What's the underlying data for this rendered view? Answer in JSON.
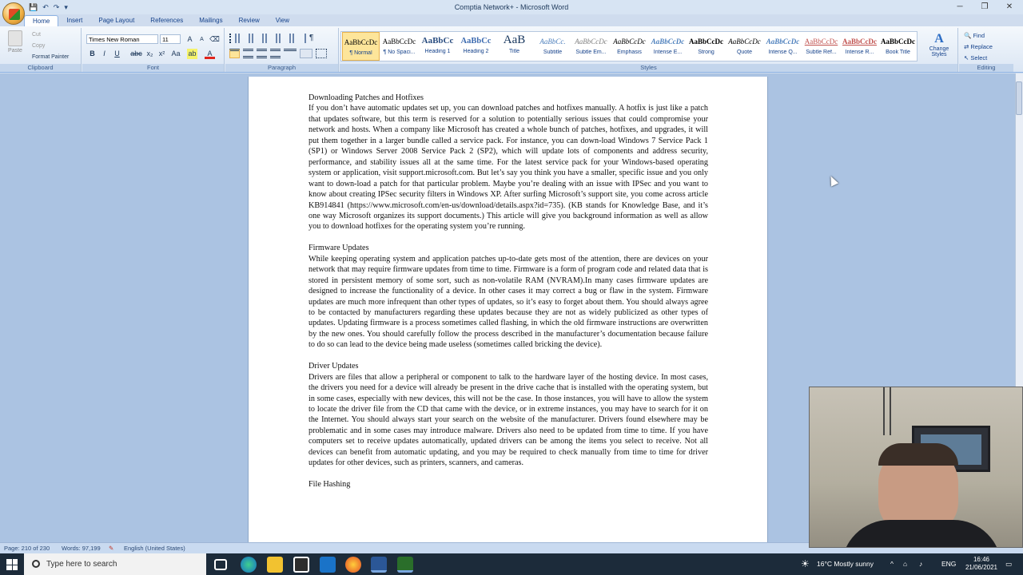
{
  "window": {
    "title": "Comptia Network+ - Microsoft Word",
    "minimize": "─",
    "restore": "❐",
    "close": "✕"
  },
  "qat": {
    "save": "💾",
    "undo": "↶",
    "redo": "↷",
    "more": "▾"
  },
  "tabs": [
    "Home",
    "Insert",
    "Page Layout",
    "References",
    "Mailings",
    "Review",
    "View"
  ],
  "clipboard": {
    "paste": "Paste",
    "cut": "Cut",
    "copy": "Copy",
    "format_painter": "Format Painter",
    "label": "Clipboard"
  },
  "font": {
    "name": "Times New Roman",
    "size": "11",
    "label": "Font",
    "bold": "B",
    "italic": "I",
    "underline": "U",
    "strike": "abc",
    "sub": "x₂",
    "sup": "x²",
    "case": "Aa",
    "grow": "A",
    "shrink": "A",
    "clear": "⌫",
    "highlight": "ab",
    "color": "A"
  },
  "paragraph": {
    "label": "Paragraph"
  },
  "styles": {
    "label": "Styles",
    "items": [
      {
        "preview": "AaBbCcDc",
        "name": "¶ Normal"
      },
      {
        "preview": "AaBbCcDc",
        "name": "¶ No Spaci..."
      },
      {
        "preview": "AaBbCc",
        "name": "Heading 1"
      },
      {
        "preview": "AaBbCc",
        "name": "Heading 2"
      },
      {
        "preview": "AaB",
        "name": "Title"
      },
      {
        "preview": "AaBbCc.",
        "name": "Subtitle"
      },
      {
        "preview": "AaBbCcDc",
        "name": "Subtle Em..."
      },
      {
        "preview": "AaBbCcDc",
        "name": "Emphasis"
      },
      {
        "preview": "AaBbCcDc",
        "name": "Intense E..."
      },
      {
        "preview": "AaBbCcDc",
        "name": "Strong"
      },
      {
        "preview": "AaBbCcDc",
        "name": "Quote"
      },
      {
        "preview": "AaBbCcDc",
        "name": "Intense Q..."
      },
      {
        "preview": "AaBbCcDc",
        "name": "Subtle Ref..."
      },
      {
        "preview": "AaBbCcDc",
        "name": "Intense R..."
      },
      {
        "preview": "AaBbCcDc",
        "name": "Book Title"
      }
    ],
    "change": "Change Styles"
  },
  "editing": {
    "label": "Editing",
    "find": "Find",
    "replace": "Replace",
    "select": "Select"
  },
  "document": {
    "h1": "Downloading Patches and Hotfixes",
    "p1": "If you don’t have automatic updates set up, you can download patches and hotfixes manually. A hotfix is just like a patch that updates software, but this term is reserved for a solution to potentially serious issues that could compromise your network and hosts. When a company like Microsoft has created a whole bunch of patches, hotfixes, and upgrades, it will put them together in a larger bundle called a service pack. For instance, you can down-load Windows 7 Service Pack 1 (SP1) or Windows Server 2008 Service Pack 2 (SP2), which will update lots of components and address security, performance, and stability issues all at the same time. For the latest service pack for your Windows-based operating system or application, visit support.microsoft.com. But let’s say you think you have a smaller, specific issue and you only want to down-load a patch for that particular problem. Maybe you’re dealing with an issue with IPSec and you want to know about creating IPSec security filters in Windows XP. After surfing Microsoft’s support site, you come across article KB914841 (https://www.microsoft.com/en-us/download/details.aspx?id=735). (KB stands for Knowledge Base, and it’s one way Microsoft organizes its support documents.) This article will give you background information as well as allow you to download hotfixes for the operating system you’re running.",
    "h2": "Firmware Updates",
    "p2": "While keeping operating system and application patches up-to-date gets most of the attention, there are devices on your network that may require firmware updates from time to time. Firmware is a form of program code and related data that is stored in persistent memory of some sort, such as non-volatile RAM (NVRAM).In many cases firmware updates are designed to increase the functionality of a device. In other cases it may correct a bug or flaw in the system. Firmware updates are much more infrequent than other types of updates, so it’s easy to forget about them. You should always agree to be contacted by manufacturers regarding these updates because they are not as widely publicized as other types of updates. Updating firmware is a process sometimes called flashing, in which the old firmware instructions are overwritten by the new ones. You should carefully follow the process described in the manufacturer’s documentation because failure to do so can lead to the device being made useless (sometimes called bricking the device).",
    "h3": "Driver Updates",
    "p3": "Drivers are files that allow a peripheral or component to talk to the hardware layer of the hosting device. In most cases, the drivers you need for a device will already be present in the drive cache that is installed with the operating system, but in some cases, especially with new devices, this will not be the case. In those instances, you will have to allow the system to locate the driver file from the CD that came with the device, or in extreme instances, you may have to search for it on the Internet. You should always start your search on the website of the manufacturer. Drivers found elsewhere may be problematic and in some cases may introduce malware. Drivers also need to be updated from time to time. If you have computers set to receive updates automatically, updated drivers can be among the items you select to receive. Not all devices can benefit from automatic updating, and you may be required to check manually from time to time for driver updates for other devices, such as printers, scanners, and cameras.",
    "h4": "File Hashing"
  },
  "status": {
    "page": "Page: 210 of 230",
    "words": "Words: 97,199",
    "language": "English (United States)"
  },
  "taskbar": {
    "search_placeholder": "Type here to search",
    "weather": "16°C  Mostly sunny",
    "lang": "ENG",
    "time": "16:46",
    "date": "21/06/2021"
  }
}
